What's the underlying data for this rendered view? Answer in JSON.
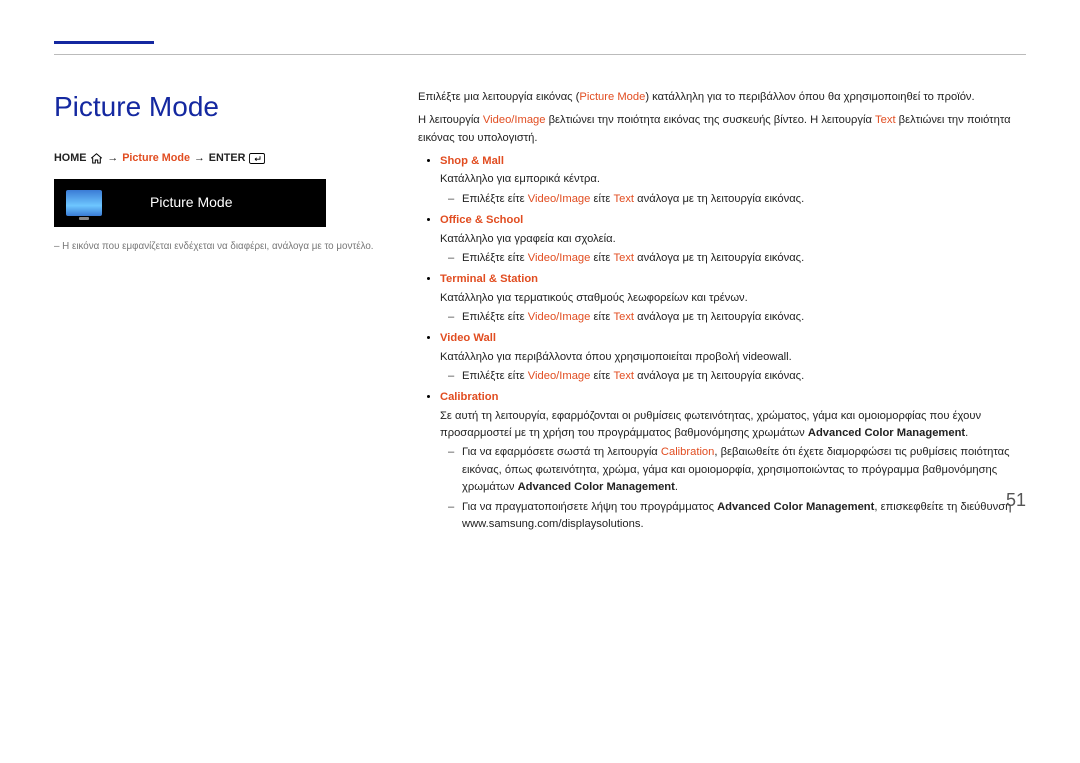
{
  "title": "Picture Mode",
  "breadcrumb": {
    "home": "HOME",
    "picture_mode": "Picture Mode",
    "enter": "ENTER"
  },
  "preview_label": "Picture Mode",
  "note": "– Η εικόνα που εμφανίζεται ενδέχεται να διαφέρει, ανάλογα με το μοντέλο.",
  "intro1_a": "Επιλέξτε μια λειτουργία εικόνας (",
  "intro1_hl": "Picture Mode",
  "intro1_b": ") κατάλληλη για το περιβάλλον όπου θα χρησιμοποιηθεί το προϊόν.",
  "intro2_a": "Η λειτουργία ",
  "intro2_hl1": "Video/Image",
  "intro2_b": " βελτιώνει την ποιότητα εικόνας της συσκευής βίντεο. Η λειτουργία ",
  "intro2_hl2": "Text",
  "intro2_c": " βελτιώνει την ποιότητα εικόνας του υπολογιστή.",
  "common_sub_a": "Επιλέξτε είτε ",
  "common_sub_v": "Video/Image",
  "common_sub_b": " είτε ",
  "common_sub_t": "Text",
  "common_sub_c": " ανάλογα με τη λειτουργία εικόνας.",
  "modes": {
    "shop": {
      "name": "Shop & Mall",
      "desc": "Κατάλληλο για εμπορικά κέντρα."
    },
    "office": {
      "name": "Office & School",
      "desc": "Κατάλληλο για γραφεία και σχολεία."
    },
    "terminal": {
      "name": "Terminal & Station",
      "desc": "Κατάλληλο για τερματικούς σταθμούς λεωφορείων και τρένων."
    },
    "video": {
      "name": "Video Wall",
      "desc": "Κατάλληλο για περιβάλλοντα όπου χρησιμοποιείται προβολή videowall."
    },
    "calib": {
      "name": "Calibration",
      "desc_a": "Σε αυτή τη λειτουργία, εφαρμόζονται οι ρυθμίσεις φωτεινότητας, χρώματος, γάμα και ομοιομορφίας που έχουν προσαρμοστεί με τη χρήση του προγράμματος βαθμονόμησης χρωμάτων ",
      "desc_b": "Advanced Color Management",
      "desc_c": ".",
      "sub1_a": "Για να εφαρμόσετε σωστά τη λειτουργία ",
      "sub1_hl": "Calibration",
      "sub1_b": ", βεβαιωθείτε ότι έχετε διαμορφώσει τις ρυθμίσεις ποιότητας εικόνας, όπως φωτεινότητα, χρώμα, γάμα και ομοιομορφία, χρησιμοποιώντας το πρόγραμμα βαθμονόμησης χρωμάτων ",
      "sub1_bold": "Advanced Color Management",
      "sub1_c": ".",
      "sub2_a": "Για να πραγματοποιήσετε λήψη του προγράμματος ",
      "sub2_bold": "Advanced Color Management",
      "sub2_b": ", επισκεφθείτε τη διεύθυνση www.samsung.com/displaysolutions."
    }
  },
  "page_number": "51"
}
